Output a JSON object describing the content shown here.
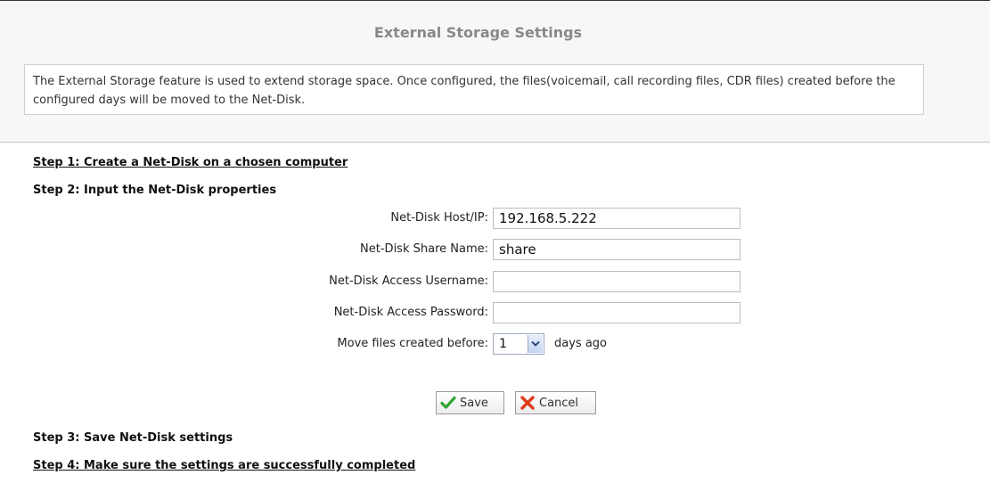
{
  "page": {
    "title": "External Storage Settings",
    "description": "The External Storage feature is used to extend storage space. Once configured, the files(voicemail, call recording files, CDR files) created before the configured days will be moved to the Net-Disk."
  },
  "steps": {
    "step1": "Step 1: Create a Net-Disk on a chosen computer",
    "step2": "Step 2: Input the Net-Disk properties",
    "step3": "Step 3: Save Net-Disk settings",
    "step4": "Step 4: Make sure the settings are successfully completed"
  },
  "form": {
    "host": {
      "label": "Net-Disk Host/IP:",
      "value": "192.168.5.222"
    },
    "share": {
      "label": "Net-Disk Share Name:",
      "value": "share"
    },
    "username": {
      "label": "Net-Disk Access Username:",
      "value": ""
    },
    "password": {
      "label": "Net-Disk Access Password:",
      "value": ""
    },
    "days": {
      "label": "Move files created before:",
      "selected": "1",
      "suffix": "days ago"
    }
  },
  "buttons": {
    "save_label": "Save",
    "cancel_label": "Cancel"
  },
  "icons": {
    "save": "checkmark-icon",
    "cancel": "x-icon",
    "dropdown": "chevron-down-icon"
  },
  "colors": {
    "save_icon": "#2fa52f",
    "cancel_icon": "#e03a1a",
    "title_text": "#888888"
  }
}
